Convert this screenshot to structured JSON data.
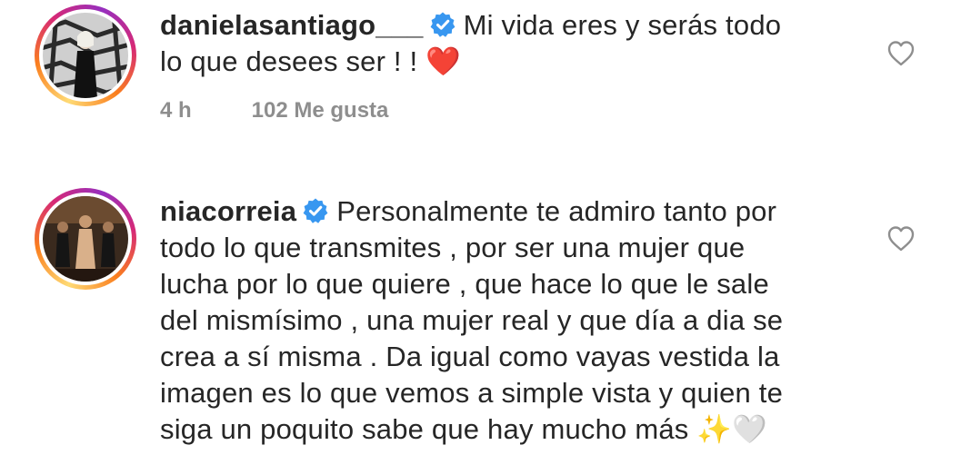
{
  "comments": [
    {
      "username": "danielasantiago___",
      "verified": true,
      "line1": "Mi vida eres y serás todo",
      "line2": "lo que desees ser ! !",
      "emoji": "❤️",
      "time": "4 h",
      "likes": "102 Me gusta",
      "avatar_icon": "profile-photo",
      "like_icon": "heart-outline-icon"
    },
    {
      "username": "niacorreia",
      "verified": true,
      "lines": [
        "Personalmente te admiro tanto por",
        "todo lo que transmites , por ser una mujer que",
        "lucha por lo que quiere , que hace lo que le sale",
        "del mismísimo , una mujer real y que día a dia se",
        "crea a sí misma . Da igual como vayas vestida la",
        "imagen es lo que vemos a simple vista y quien te",
        "siga un poquito sabe que hay mucho más"
      ],
      "emoji": "✨🤍",
      "avatar_icon": "profile-photo",
      "like_icon": "heart-outline-icon"
    }
  ],
  "colors": {
    "text": "#262626",
    "meta": "#8e8e8e",
    "verified": "#3897f0",
    "heart_emoji": "#e0245e"
  }
}
